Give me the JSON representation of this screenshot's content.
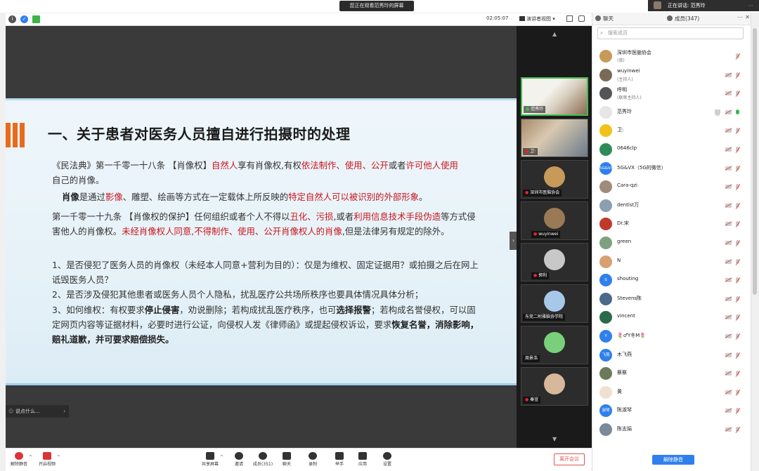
{
  "top": {
    "share_banner": "您正在观看范秀玲的屏幕",
    "speaking": "正在讲话: 范秀玲"
  },
  "meetbar": {
    "timer": "02:05:07",
    "view_label": "演讲者视图"
  },
  "slide": {
    "title": "一、关于患者对医务人员擅自进行拍摄时的处理",
    "p1_a": "《民法典》第一千零一十八条 【肖像权】",
    "p1_b": "自然人",
    "p1_c": "享有肖像权,有权",
    "p1_d": "依法制作、使用、公开",
    "p1_e": "或者",
    "p1_f": "许可他人使用",
    "p1_g": "自己的肖像。",
    "p2_a": "肖像",
    "p2_b": "是通过",
    "p2_c": "影像",
    "p2_d": "、雕塑、绘画等方式在一定载体上所反映的",
    "p2_e": "特定自然人可以被识别的外部形象",
    "p2_f": "。",
    "p3_a": "第一千零一十九条 【肖像权的保护】",
    "p3_b": "任何组织或者个人不得以",
    "p3_c": "丑化、污损",
    "p3_d": ",或者",
    "p3_e": "利用信息技术手段伪造",
    "p3_f": "等方式侵害他人的肖像权。",
    "p3_g": "未经肖像权人同意,不得制作、使用、公开肖像权人的肖像",
    "p3_h": ",但是法律另有规定的除外。",
    "q1": "1、是否侵犯了医务人员的肖像权（未经本人同意+营利为目的）：仅是为维权、固定证据用？或拍摄之后在网上诋毁医务人员？",
    "q2": "2、是否涉及侵犯其他患者或医务人员个人隐私，扰乱医疗公共场所秩序也要具体情况具体分析；",
    "q3_a": "3、如何维权：有权要求",
    "q3_b": "停止侵害",
    "q3_c": "，劝说删除；若构成扰乱医疗秩序，也可",
    "q3_d": "选择报警",
    "q3_e": "；若构成名誉侵权，可以固定网页内容等证据材料，必要时进行公证，向侵权人发《律师函》或提起侵权诉讼，要求",
    "q3_f": "恢复名誉，消除影响，赔礼道歉，并可要求赔偿损失。"
  },
  "comment_placeholder": "说点什么...",
  "video_tiles": [
    {
      "name": "范秀玲"
    },
    {
      "name": "卫:"
    },
    {
      "name": "深圳市医脑协会"
    },
    {
      "name": "wuyinwei"
    },
    {
      "name": "郭利"
    },
    {
      "name": "东莞二附雅脑协学院"
    },
    {
      "name": "周景浩"
    },
    {
      "name": "秦宣"
    }
  ],
  "panel": {
    "tab_chat": "聊天",
    "tab_members": "成员(347)",
    "search_placeholder": "搜索成员",
    "members": [
      {
        "name": "深圳市医脑协会",
        "sub": "(我)",
        "color": "#c79a5a"
      },
      {
        "name": "wuyinwei",
        "sub": "(主持人)",
        "color": "#7a6a55"
      },
      {
        "name": "呼明",
        "sub": "(联席主持人)",
        "color": "#555555"
      },
      {
        "name": "范秀玲",
        "sub": "",
        "color": "#e6e6e6"
      },
      {
        "name": "卫:",
        "sub": "",
        "color": "#f2c21a"
      },
      {
        "name": "0646clp",
        "sub": "",
        "color": "#2e8b57"
      },
      {
        "name": "5G&VX（5G的微信）",
        "sub": "",
        "color": "#2f80ed",
        "initials": "5G&VX"
      },
      {
        "name": "Cara-qzi",
        "sub": "",
        "color": "#a08a7a"
      },
      {
        "name": "dentist万",
        "sub": "",
        "color": "#8aa0b0"
      },
      {
        "name": "Dr.宋",
        "sub": "",
        "color": "#c0392b"
      },
      {
        "name": "green",
        "sub": "",
        "color": "#7fa07f"
      },
      {
        "name": "N",
        "sub": "",
        "color": "#d8a070"
      },
      {
        "name": "shouting",
        "sub": "",
        "color": "#2f80ed",
        "initials": "S"
      },
      {
        "name": "Stevens陈",
        "sub": "",
        "color": "#4a6a8a"
      },
      {
        "name": "vincent",
        "sub": "",
        "color": "#2a6a4a"
      },
      {
        "name": "🌷♂Y冬M🌷",
        "sub": "",
        "color": "#2f80ed",
        "initials": "Y"
      },
      {
        "name": "木飞燕",
        "sub": "",
        "color": "#2f80ed",
        "initials": "飞燕"
      },
      {
        "name": "蔡蔡",
        "sub": "",
        "color": "#6a7a5a"
      },
      {
        "name": "黄",
        "sub": "",
        "color": "#f0e0d0"
      },
      {
        "name": "陈淑琴",
        "sub": "",
        "color": "#2f80ed",
        "initials": "淑琴"
      },
      {
        "name": "陈志娟",
        "sub": "",
        "color": "#7a8a9a"
      }
    ],
    "mute_all": "解除静音"
  },
  "toolbar": {
    "unmute": "解除静音",
    "video": "开启视频",
    "share": "共享屏幕",
    "invite": "邀请",
    "members": "成员(351)",
    "chat": "聊天",
    "record": "录制",
    "raise_hand": "举手",
    "apps": "应用",
    "settings": "设置",
    "leave": "离开会议"
  }
}
